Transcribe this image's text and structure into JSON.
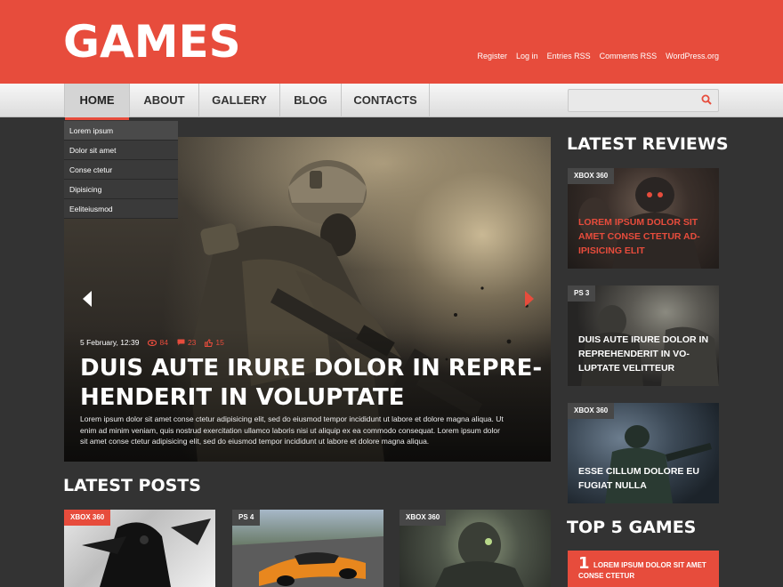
{
  "brand": {
    "logo": "GAMES",
    "accent": "#e74c3c"
  },
  "toplinks": [
    "Register",
    "Log in",
    "Entries RSS",
    "Comments RSS",
    "WordPress.org"
  ],
  "nav": {
    "items": [
      "HOME",
      "ABOUT",
      "GALLERY",
      "BLOG",
      "CONTACTS"
    ],
    "active": "HOME",
    "dropdown": [
      "Lorem ipsum",
      "Dolor sit amet",
      "Conse ctetur",
      "Dipisicing",
      "Eeliteiusmod"
    ],
    "search_placeholder": ""
  },
  "hero": {
    "date": "5  February, 12:39",
    "views": "84",
    "comments": "23",
    "likes": "15",
    "title": "DUIS AUTE IRURE DOLOR IN REPRE-HENDERIT IN VOLUPTATE",
    "text": "Lorem ipsum dolor sit amet conse ctetur adipisicing elit, sed do eiusmod tempor incididunt ut labore et dolore magna aliqua. Ut enim ad minim veniam, quis nostrud exercitation ullamco laboris nisi ut aliquip ex ea commodo consequat. Lorem ipsum dolor sit amet conse ctetur adipisicing elit, sed do eiusmod tempor incididunt ut labore et dolore magna aliqua."
  },
  "latest_reviews": {
    "title": "LATEST REVIEWS",
    "items": [
      {
        "tag": "XBOX 360",
        "caption": "LOREM IPSUM DOLOR SIT AMET CONSE CTETUR AD-IPISICING ELIT",
        "caption_color": "#e74c3c"
      },
      {
        "tag": "PS 3",
        "caption": "DUIS AUTE IRURE DOLOR IN REPREHENDERIT IN VO-LUPTATE VELITTEUR",
        "caption_color": "#ffffff"
      },
      {
        "tag": "XBOX 360",
        "caption": "ESSE CILLUM DOLORE EU FUGIAT NULLA",
        "caption_color": "#ffffff"
      }
    ]
  },
  "top5": {
    "title": "TOP 5 GAMES",
    "items": [
      {
        "rank": "1",
        "text": "LOREM IPSUM DOLOR SIT AMET CONSE CTETUR"
      }
    ]
  },
  "latest_posts": {
    "title": "LATEST POSTS",
    "items": [
      {
        "tag": "XBOX 360"
      },
      {
        "tag": "PS 4"
      },
      {
        "tag": "XBOX 360"
      }
    ]
  }
}
